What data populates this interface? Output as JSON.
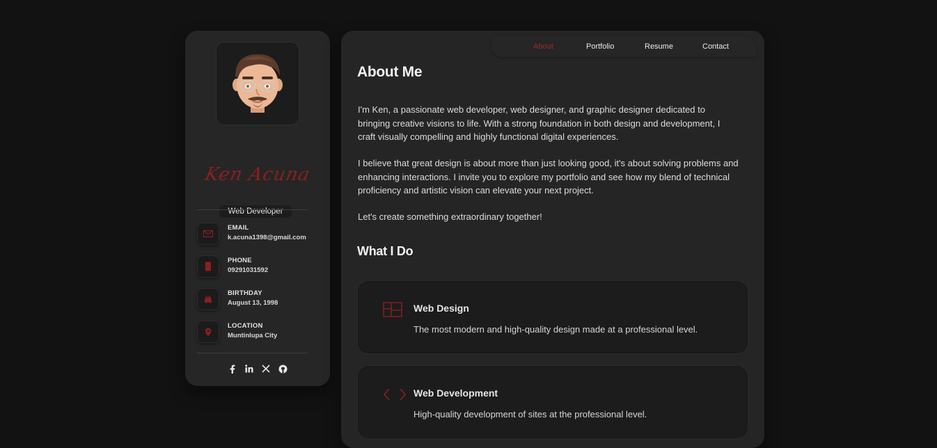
{
  "profile": {
    "name_signature": "Ken Acuna",
    "role": "Web Developer"
  },
  "contacts": [
    {
      "label": "EMAIL",
      "value": "k.acuna1398@gmail.com",
      "icon": "mail-icon"
    },
    {
      "label": "PHONE",
      "value": "09291031592",
      "icon": "phone-icon"
    },
    {
      "label": "BIRTHDAY",
      "value": "August 13, 1998",
      "icon": "cake-icon"
    },
    {
      "label": "LOCATION",
      "value": "Muntinlupa City",
      "icon": "location-pin-icon"
    }
  ],
  "socials": [
    "facebook-icon",
    "linkedin-icon",
    "x-icon",
    "github-icon"
  ],
  "nav": {
    "about": "About",
    "portfolio": "Portfolio",
    "resume": "Resume",
    "contact": "Contact",
    "active": "About"
  },
  "about": {
    "heading": "About Me",
    "p1": "I'm Ken, a passionate web developer, web designer, and graphic designer dedicated to bringing creative visions to life. With a strong foundation in both design and development, I craft visually compelling and highly functional digital experiences.",
    "p2": "I believe that great design is about more than just looking good, it's about solving problems and enhancing interactions. I invite you to explore my portfolio and see how my blend of technical proficiency and artistic vision can elevate your next project.",
    "p3": "Let's create something extraordinary together!"
  },
  "services": {
    "heading": "What I Do",
    "items": [
      {
        "title": "Web Design",
        "desc": "The most modern and high-quality design made at a professional level.",
        "icon": "layout-icon"
      },
      {
        "title": "Web Development",
        "desc": "High-quality development of sites at the professional level.",
        "icon": "code-icon"
      }
    ]
  },
  "colors": {
    "accent": "#8c1f1f",
    "background": "#121212",
    "panel": "#262626"
  }
}
